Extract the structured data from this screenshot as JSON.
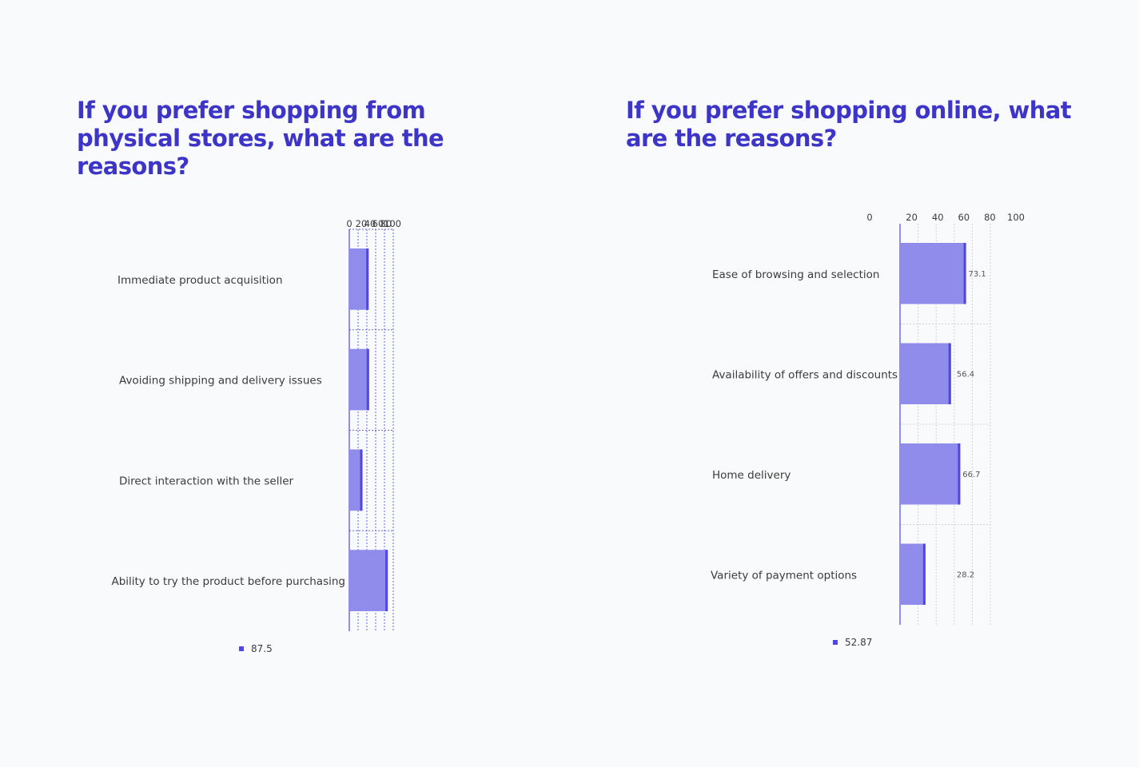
{
  "colors": {
    "title": "#3d35c7",
    "bar_fill": "#8f8cec",
    "bar_edge": "#4f46e5",
    "grid": "#cfd2d8",
    "axis": "#4f46e5"
  },
  "left": {
    "title": "If you prefer shopping from physical stores, what are the reasons?",
    "legend_value": "87.5"
  },
  "right": {
    "title": "If you prefer shopping online, what are the reasons?",
    "legend_value": "52.87"
  },
  "chart_data": [
    {
      "type": "bar",
      "orientation": "horizontal",
      "title": "If you prefer shopping from physical stores, what are the reasons?",
      "categories": [
        "Immediate product acquisition",
        "Avoiding shipping and delivery issues",
        "Direct interaction with the seller",
        "Ability to try the product before purchasing"
      ],
      "values": [
        44,
        45,
        30,
        87.5
      ],
      "data_labels": [
        "",
        "",
        "",
        ""
      ],
      "xlim": [
        0,
        100
      ],
      "xticks": [
        "0",
        "20",
        "40",
        "60",
        "80",
        "100"
      ],
      "legend": [
        "87.5"
      ],
      "legend_position": "bottom",
      "grid": true,
      "axis_position": "top"
    },
    {
      "type": "bar",
      "orientation": "horizontal",
      "title": "If you prefer shopping online, what are the reasons?",
      "categories": [
        "Ease of browsing and selection",
        "Availability of offers and discounts",
        "Home delivery",
        "Variety of payment options"
      ],
      "values": [
        73.1,
        56.4,
        66.7,
        28.2
      ],
      "data_labels": [
        "73.1",
        "56.4",
        "66.7",
        "28.2"
      ],
      "xlim": [
        0,
        100
      ],
      "xticks": [
        "0",
        "20",
        "40",
        "60",
        "80",
        "100"
      ],
      "legend": [
        "52.87"
      ],
      "legend_position": "bottom",
      "grid": true,
      "axis_position": "top"
    }
  ]
}
